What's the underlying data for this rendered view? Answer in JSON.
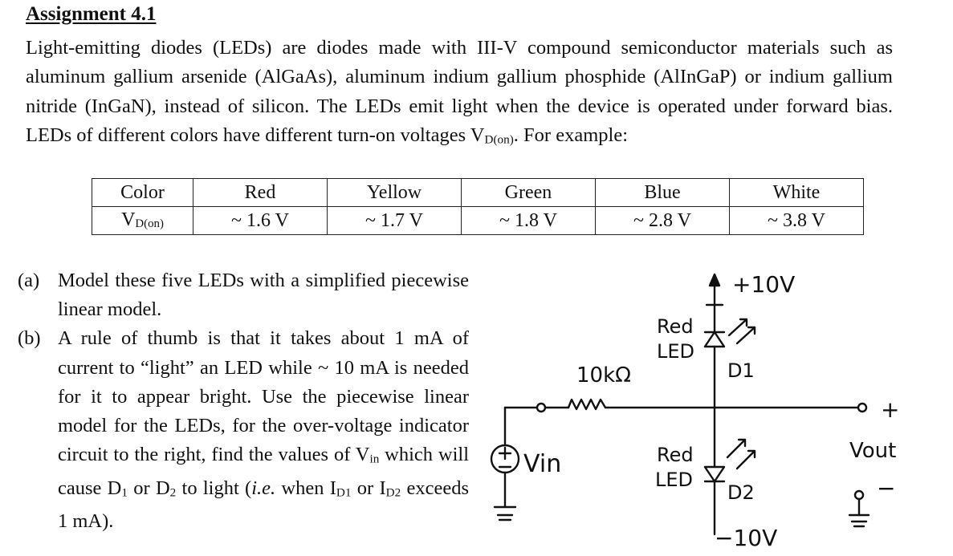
{
  "title": "Assignment 4.1",
  "intro": {
    "text": "Light-emitting diodes (LEDs) are diodes made with III-V compound semiconductor materials such as aluminum gallium arsenide (AlGaAs), aluminum indium gallium phosphide (AlInGaP) or indium gallium nitride (InGaN), instead of silicon. The LEDs emit light when the device is operated under forward bias. LEDs of different colors have different turn-on voltages V",
    "sub": "D(on)",
    "tail": ". For example:"
  },
  "table": {
    "header_label": "Color",
    "row_label_main": "V",
    "row_label_sub": "D(on)",
    "colors": [
      "Red",
      "Yellow",
      "Green",
      "Blue",
      "White"
    ],
    "voltages": [
      "~ 1.6 V",
      "~ 1.7 V",
      "~ 1.8 V",
      "~ 2.8 V",
      "~ 3.8 V"
    ]
  },
  "parts": [
    {
      "label": "(a)",
      "text": "Model these five LEDs with a simplified piecewise linear model."
    },
    {
      "label": "(b)",
      "text_1": "A rule of thumb is that it takes about 1 mA of current to “light” an LED while ~ 10 mA is needed for it to appear bright. Use the piecewise linear model for the LEDs, for the over-voltage indicator circuit to the right, find the values of V",
      "sub_in": "in",
      "text_2": " which will cause D",
      "sub_1": "1",
      "text_3": " or D",
      "sub_2": "2",
      "text_4": " to light (",
      "italic": "i.e.",
      "text_5": " when I",
      "sub_d1": "D1",
      "text_6": " or I",
      "sub_d2": "D2",
      "text_7": " exceeds 1 mA)."
    }
  ],
  "circuit": {
    "top_supply": "+10V",
    "bottom_supply": "−10V",
    "resistor": "10kΩ",
    "source": "Vin",
    "led_top_label_1": "Red",
    "led_top_label_2": "LED",
    "led_top_name": "D1",
    "led_bottom_label_1": "Red",
    "led_bottom_label_2": "LED",
    "led_bottom_name": "D2",
    "output": "Vout",
    "out_plus": "+",
    "out_minus": "−",
    "source_plus": "+"
  }
}
